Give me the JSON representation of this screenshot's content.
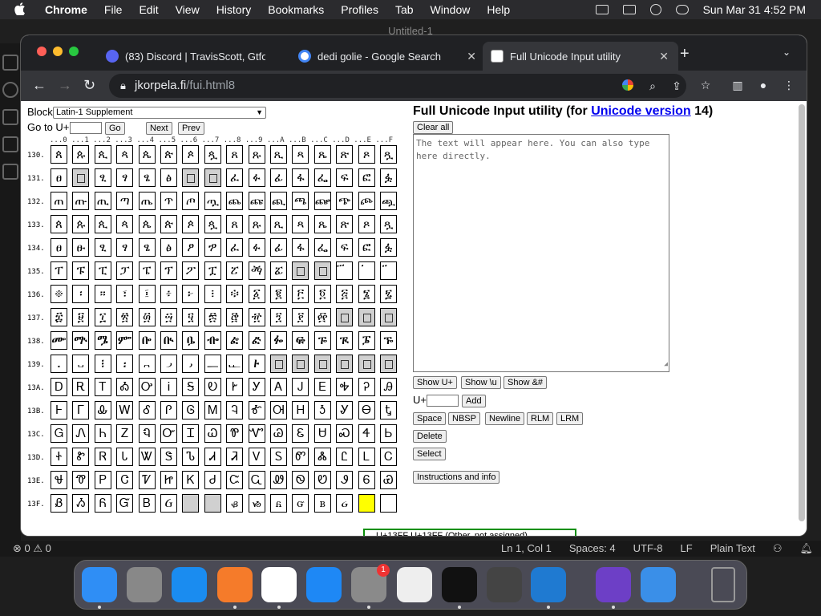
{
  "menubar": {
    "items": [
      "Chrome",
      "File",
      "Edit",
      "View",
      "History",
      "Bookmarks",
      "Profiles",
      "Tab",
      "Window",
      "Help"
    ],
    "clock": "Sun Mar 31  4:52 PM"
  },
  "editor": {
    "title": "Untitled-1",
    "status": {
      "problems": "⊗ 0 ⚠ 0",
      "position": "Ln 1, Col 1",
      "spaces": "Spaces: 4",
      "encoding": "UTF-8",
      "eol": "LF",
      "language": "Plain Text"
    }
  },
  "browser": {
    "tabs": [
      {
        "title": "(83) Discord | TravisScott, Gtfo",
        "badge": "83",
        "color": "#5865f2"
      },
      {
        "title": "dedi golie - Google Search",
        "color": "#4285f4"
      },
      {
        "title": "Full Unicode Input utility",
        "color": "#ffffff"
      }
    ],
    "url_host": "jkorpela.fi",
    "url_path": "/fui.html8"
  },
  "page": {
    "block_label": "Block:",
    "block_value": "Latin-1 Supplement",
    "goto_label": "Go to U+",
    "go_button": "Go",
    "next_button": "Next",
    "prev_button": "Prev",
    "col_header": "...0 ...1 ...2 ...3 ...4 ...5 ...6 ...7 ...8 ...9 ...A ...B ...C ...D ...E ...F",
    "title_prefix": "Full Unicode Input utility (for ",
    "title_link": "Unicode version",
    "title_suffix": " 14)",
    "clear_button": "Clear all",
    "textarea_placeholder": "The text will appear here. You can also type here directly.",
    "show_buttons": [
      "Show U+",
      "Show \\u",
      "Show &#"
    ],
    "uplus_label": "U+",
    "add_button": "Add",
    "insert_buttons": [
      "Space",
      "NBSP",
      "Newline",
      "RLM",
      "LRM"
    ],
    "delete_button": "Delete",
    "select_button": "Select",
    "instructions_button": "Instructions and info",
    "tooltip": "U+13FF U+13FF (Other, not assigned)",
    "rows": [
      {
        "label": "130.",
        "cells": [
          "ጰ",
          "ጱ",
          "ጲ",
          "ጳ",
          "ጴ",
          "ጵ",
          "ጶ",
          "ጷ",
          "ጸ",
          "ጹ",
          "ጺ",
          "ጻ",
          "ጼ",
          "ጽ",
          "ጾ",
          "ጿ"
        ]
      },
      {
        "label": "131.",
        "cells": [
          "ፀ",
          "",
          "ፂ",
          "ፃ",
          "ፄ",
          "ፅ",
          "",
          "",
          "ፈ",
          "ፉ",
          "ፊ",
          "ፋ",
          "ፌ",
          "ፍ",
          "ፎ",
          "ፏ"
        ]
      },
      {
        "label": "132.",
        "cells": [
          "ጠ",
          "ጡ",
          "ጢ",
          "ጣ",
          "ጤ",
          "ጥ",
          "ጦ",
          "ጧ",
          "ጨ",
          "ጩ",
          "ጪ",
          "ጫ",
          "ጬ",
          "ጭ",
          "ጮ",
          "ጯ"
        ]
      },
      {
        "label": "133.",
        "cells": [
          "ጰ",
          "ጱ",
          "ጲ",
          "ጳ",
          "ጴ",
          "ጵ",
          "ጶ",
          "ጷ",
          "ጸ",
          "ጹ",
          "ጺ",
          "ጻ",
          "ጼ",
          "ጽ",
          "ጾ",
          "ጿ"
        ]
      },
      {
        "label": "134.",
        "cells": [
          "ፀ",
          "ፁ",
          "ፂ",
          "ፃ",
          "ፄ",
          "ፅ",
          "ፆ",
          "ፇ",
          "ፈ",
          "ፉ",
          "ፊ",
          "ፋ",
          "ፌ",
          "ፍ",
          "ፎ",
          "ፏ"
        ]
      },
      {
        "label": "135.",
        "cells": [
          "ፐ",
          "ፑ",
          "ፒ",
          "ፓ",
          "ፔ",
          "ፕ",
          "ፖ",
          "ፗ",
          "ፘ",
          "ፙ",
          "ፚ",
          "",
          "",
          "፝",
          "፞",
          "፟"
        ]
      },
      {
        "label": "136.",
        "cells": [
          "፠",
          "፡",
          "።",
          "፣",
          "፤",
          "፥",
          "፦",
          "፧",
          "፨",
          "፩",
          "፪",
          "፫",
          "፬",
          "፭",
          "፮",
          "፯"
        ]
      },
      {
        "label": "137.",
        "cells": [
          "፰",
          "፱",
          "፲",
          "፳",
          "፴",
          "፵",
          "፶",
          "፷",
          "፸",
          "፹",
          "፺",
          "፻",
          "፼",
          "",
          "",
          ""
        ]
      },
      {
        "label": "138.",
        "cells": [
          "ᎀ",
          "ᎁ",
          "ᎂ",
          "ᎃ",
          "ᎄ",
          "ᎅ",
          "ᎆ",
          "ᎇ",
          "ᎈ",
          "ᎉ",
          "ᎊ",
          "ᎋ",
          "ᎌ",
          "ᎍ",
          "ᎎ",
          "ᎏ"
        ]
      },
      {
        "label": "139.",
        "cells": [
          "᎐",
          "᎑",
          "᎒",
          "᎓",
          "᎔",
          "᎕",
          "᎖",
          "᎗",
          "᎘",
          "᎙",
          "",
          "",
          "",
          "",
          "",
          ""
        ]
      },
      {
        "label": "13A.",
        "cells": [
          "Ꭰ",
          "Ꭱ",
          "Ꭲ",
          "Ꭳ",
          "Ꭴ",
          "Ꭵ",
          "Ꭶ",
          "Ꭷ",
          "Ꭸ",
          "Ꭹ",
          "Ꭺ",
          "Ꭻ",
          "Ꭼ",
          "Ꭽ",
          "Ꭾ",
          "Ꭿ"
        ]
      },
      {
        "label": "13B.",
        "cells": [
          "Ꮀ",
          "Ꮁ",
          "Ꮂ",
          "Ꮃ",
          "Ꮄ",
          "Ꮅ",
          "Ꮆ",
          "Ꮇ",
          "Ꮈ",
          "Ꮉ",
          "Ꮊ",
          "Ꮋ",
          "Ꮌ",
          "Ꮍ",
          "Ꮎ",
          "Ꮏ"
        ]
      },
      {
        "label": "13C.",
        "cells": [
          "Ꮐ",
          "Ꮑ",
          "Ꮒ",
          "Ꮓ",
          "Ꮔ",
          "Ꮕ",
          "Ꮖ",
          "Ꮗ",
          "Ꮘ",
          "Ꮙ",
          "Ꮚ",
          "Ꮛ",
          "Ꮜ",
          "Ꮝ",
          "Ꮞ",
          "Ꮟ"
        ]
      },
      {
        "label": "13D.",
        "cells": [
          "Ꮠ",
          "Ꮡ",
          "Ꮢ",
          "Ꮣ",
          "Ꮤ",
          "Ꮥ",
          "Ꮦ",
          "Ꮧ",
          "Ꮨ",
          "Ꮩ",
          "Ꮪ",
          "Ꮫ",
          "Ꮬ",
          "Ꮭ",
          "Ꮮ",
          "Ꮯ"
        ]
      },
      {
        "label": "13E.",
        "cells": [
          "Ꮰ",
          "Ꮱ",
          "Ꮲ",
          "Ꮳ",
          "Ꮴ",
          "Ꮵ",
          "Ꮶ",
          "Ꮷ",
          "Ꮸ",
          "Ꮹ",
          "Ꮺ",
          "Ꮻ",
          "Ꮼ",
          "Ꮽ",
          "Ꮾ",
          "Ꮿ"
        ]
      },
      {
        "label": "13F.",
        "cells": [
          "Ᏸ",
          "Ᏹ",
          "Ᏺ",
          "Ᏻ",
          "Ᏼ",
          "Ᏽ",
          "",
          "",
          "ᏸ",
          "ᏹ",
          "ᏺ",
          "ᏻ",
          "ᏼ",
          "ᏽ",
          "",
          ""
        ]
      }
    ],
    "unassigned": {
      "131.": [
        1,
        6,
        7
      ],
      "135.": [
        11,
        12
      ],
      "137.": [
        13,
        14,
        15
      ],
      "139.": [
        10,
        11,
        12,
        13,
        14,
        15
      ]
    },
    "shaded": {
      "13F.": [
        6,
        7
      ]
    },
    "highlight": {
      "row": "13F.",
      "col": 14
    }
  },
  "dock": {
    "apps": [
      "finder-icon",
      "launchpad-icon",
      "safari-icon",
      "firefox-icon",
      "chrome-icon",
      "app-store-icon",
      "system-settings-icon",
      "textedit-icon",
      "terminal-icon",
      "garageband-icon",
      "vscode-icon",
      "visual-studio-icon",
      "weather-icon",
      "trash-icon"
    ],
    "settings_badge": "1"
  }
}
